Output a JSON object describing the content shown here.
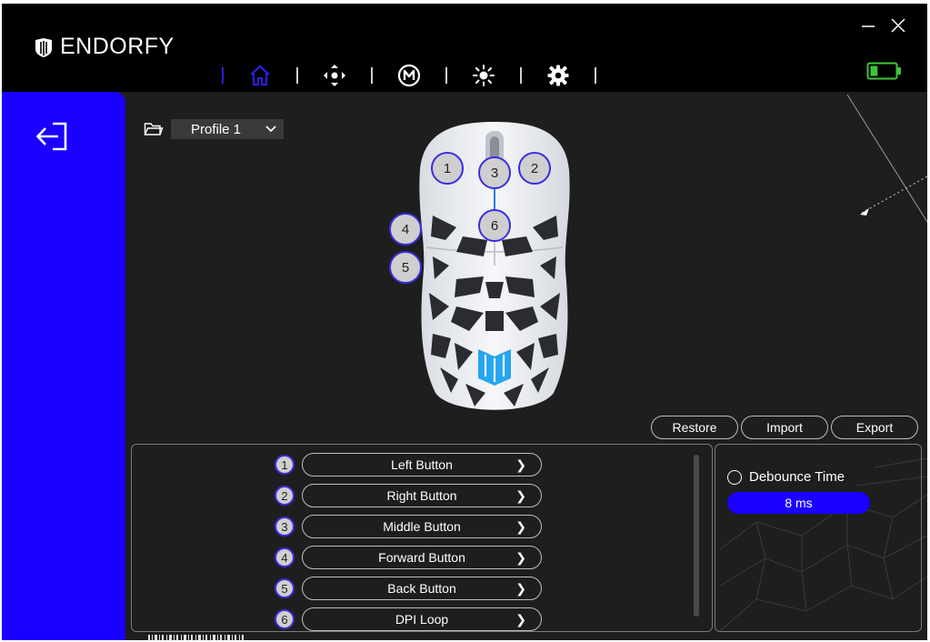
{
  "app": {
    "brand": "ENDORFY"
  },
  "window_controls": {
    "minimize_icon": "minimize-icon",
    "close_icon": "close-icon"
  },
  "nav": {
    "items": [
      {
        "id": "home",
        "icon": "home-icon",
        "active": true
      },
      {
        "id": "buttons",
        "icon": "crosshair-icon",
        "active": false
      },
      {
        "id": "macro",
        "icon": "macro-m-icon",
        "active": false
      },
      {
        "id": "lighting",
        "icon": "brightness-icon",
        "active": false
      },
      {
        "id": "settings",
        "icon": "gear-icon",
        "active": false
      }
    ]
  },
  "battery": {
    "icon": "battery-icon",
    "level": 0.3
  },
  "sidebar": {
    "back_icon": "back-arrow-icon",
    "accent": "#1a00ff"
  },
  "profile": {
    "folder_icon": "folder-icon",
    "selected": "Profile 1"
  },
  "mouse_badges": [
    "1",
    "2",
    "3",
    "4",
    "5",
    "6"
  ],
  "actions": {
    "restore": "Restore",
    "import": "Import",
    "export": "Export"
  },
  "buttons": [
    {
      "num": "1",
      "label": "Left Button"
    },
    {
      "num": "2",
      "label": "Right Button"
    },
    {
      "num": "3",
      "label": "Middle Button"
    },
    {
      "num": "4",
      "label": "Forward Button"
    },
    {
      "num": "5",
      "label": "Back Button"
    },
    {
      "num": "6",
      "label": "DPI Loop"
    }
  ],
  "debounce": {
    "label": "Debounce Time",
    "value": "8 ms"
  },
  "colors": {
    "accent": "#1a00ff",
    "active_nav": "#2b1fd6",
    "battery_green": "#3ec43e",
    "background": "#1e1e1e"
  }
}
